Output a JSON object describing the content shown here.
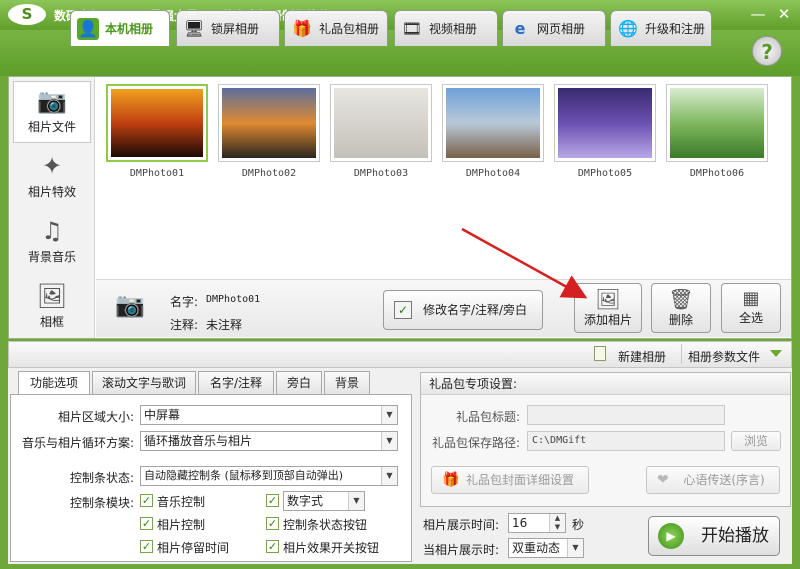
{
  "window": {
    "logo": "S",
    "title": "数码大师2013",
    "slogan": "最强大最易用的家庭相册制作软件",
    "min": "—",
    "close": "✕"
  },
  "tabs": [
    {
      "label": "本机相册",
      "icon": "person-icon"
    },
    {
      "label": "锁屏相册",
      "icon": "monitor-icon"
    },
    {
      "label": "礼品包相册",
      "icon": "gift-icon"
    },
    {
      "label": "视频相册",
      "icon": "film-icon"
    },
    {
      "label": "网页相册",
      "icon": "ie-icon"
    },
    {
      "label": "升级和注册",
      "icon": "globe-icon"
    }
  ],
  "help": "?",
  "sidebar": [
    {
      "label": "相片文件",
      "icon": "camera-icon"
    },
    {
      "label": "相片特效",
      "icon": "effects-icon"
    },
    {
      "label": "背景音乐",
      "icon": "music-note-icon"
    },
    {
      "label": "相框",
      "icon": "frame-icon"
    }
  ],
  "photos": [
    {
      "name": "DMPhoto01",
      "colors": [
        "#f0a020",
        "#c04010",
        "#1a0a05"
      ]
    },
    {
      "name": "DMPhoto02",
      "colors": [
        "#5a6fa0",
        "#e08a30",
        "#2a2520"
      ]
    },
    {
      "name": "DMPhoto03",
      "colors": [
        "#e8e6e0",
        "#d5d3cc",
        "#c4c1b8"
      ]
    },
    {
      "name": "DMPhoto04",
      "colors": [
        "#6fa0d8",
        "#b8c8d8",
        "#7a6048"
      ]
    },
    {
      "name": "DMPhoto05",
      "colors": [
        "#3a2a70",
        "#6a50b0",
        "#b8a8e8"
      ]
    },
    {
      "name": "DMPhoto06",
      "colors": [
        "#d8ecd0",
        "#80b860",
        "#3a7a28"
      ]
    }
  ],
  "info": {
    "name_label": "名字:",
    "name_value": "DMPhoto01",
    "note_label": "注释:",
    "note_value": "未注释",
    "edit_button": "修改名字/注释/旁白"
  },
  "actions": {
    "add": "添加相片",
    "delete": "删除",
    "select_all": "全选"
  },
  "toolbar": {
    "new_album": "新建相册",
    "album_params": "相册参数文件"
  },
  "bottom_tabs": [
    "功能选项",
    "滚动文字与歌词",
    "名字/注释",
    "旁白",
    "背景"
  ],
  "options": {
    "area_label": "相片区域大小:",
    "area_value": "中屏幕",
    "loop_label": "音乐与相片循环方案:",
    "loop_value": "循环播放音乐与相片",
    "ctrl_label": "控制条状态:",
    "ctrl_value": "自动隐藏控制条 (鼠标移到顶部自动弹出)",
    "module_label": "控制条模块:",
    "checks": [
      "音乐控制",
      "数字式",
      "相片控制",
      "控制条状态按钮",
      "相片停留时间",
      "相片效果开关按钮"
    ]
  },
  "gift": {
    "header": "礼品包专项设置:",
    "title_label": "礼品包标题:",
    "title_value": "",
    "path_label": "礼品包保存路径:",
    "path_value": "C:\\DMGift",
    "browse": "浏览",
    "cover_btn": "礼品包封面详细设置",
    "msg_btn": "心语传送(序言)"
  },
  "timing": {
    "show_time_label": "相片展示时间:",
    "show_time_value": "16",
    "unit": "秒",
    "when_label": "当相片展示时:",
    "when_value": "双重动态"
  },
  "play": "开始播放"
}
